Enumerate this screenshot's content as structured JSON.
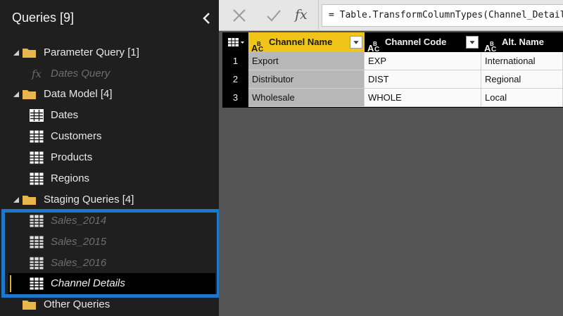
{
  "queries_pane": {
    "title": "Queries [9]",
    "groups": [
      {
        "label": "Parameter Query [1]",
        "items": [
          {
            "label": "Dates Query",
            "kind": "function"
          }
        ]
      },
      {
        "label": "Data Model [4]",
        "items": [
          {
            "label": "Dates",
            "kind": "table"
          },
          {
            "label": "Customers",
            "kind": "table"
          },
          {
            "label": "Products",
            "kind": "table"
          },
          {
            "label": "Regions",
            "kind": "table"
          }
        ]
      },
      {
        "label": "Staging Queries [4]",
        "items": [
          {
            "label": "Sales_2014",
            "kind": "table"
          },
          {
            "label": "Sales_2015",
            "kind": "table"
          },
          {
            "label": "Sales_2016",
            "kind": "table"
          },
          {
            "label": "Channel Details",
            "kind": "table",
            "selected": true
          }
        ]
      },
      {
        "label": "Other Queries",
        "items": []
      }
    ]
  },
  "formula_bar": {
    "fx_label": "fx",
    "formula": "= Table.TransformColumnTypes(Channel_Details"
  },
  "grid": {
    "columns": [
      {
        "name": "Channel Name",
        "type": "text",
        "selected": true
      },
      {
        "name": "Channel Code",
        "type": "text"
      },
      {
        "name": "Alt. Name",
        "type": "text"
      }
    ],
    "rows": [
      {
        "num": "1",
        "cells": [
          "Export",
          "EXP",
          "International"
        ]
      },
      {
        "num": "2",
        "cells": [
          "Distributor",
          "DIST",
          "Regional"
        ]
      },
      {
        "num": "3",
        "cells": [
          "Wholesale",
          "WHOLE",
          "Local"
        ]
      }
    ]
  },
  "colors": {
    "selected_column": "#f0c419",
    "highlight_box": "#1f77c9",
    "selection_bar": "#e2b021"
  }
}
